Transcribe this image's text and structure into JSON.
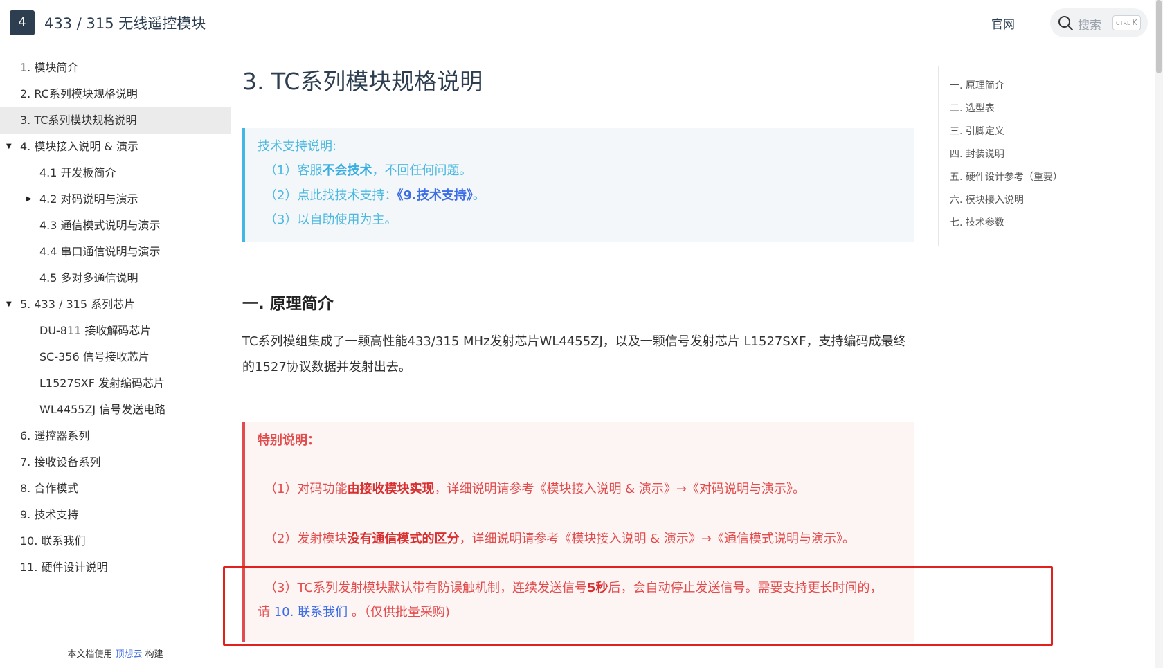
{
  "header": {
    "logo_text": "4",
    "site_title": "433 / 315 无线遥控模块",
    "nav_link": "官网",
    "search_placeholder": "搜索",
    "search_shortcut_mod": "CTRL",
    "search_shortcut_key": "K"
  },
  "sidebar": {
    "items": [
      {
        "label": "1. 模块简介"
      },
      {
        "label": "2. RC系列模块规格说明"
      },
      {
        "label": "3. TC系列模块规格说明"
      },
      {
        "label": "4. 模块接入说明 & 演示"
      },
      {
        "label": "4.1 开发板简介"
      },
      {
        "label": "4.2 对码说明与演示"
      },
      {
        "label": "4.3 通信模式说明与演示"
      },
      {
        "label": "4.4 串口通信说明与演示"
      },
      {
        "label": "4.5 多对多通信说明"
      },
      {
        "label": "5. 433 / 315 系列芯片"
      },
      {
        "label": "DU-811 接收解码芯片"
      },
      {
        "label": "SC-356 信号接收芯片"
      },
      {
        "label": "L1527SXF 发射编码芯片"
      },
      {
        "label": "WL4455ZJ 信号发送电路"
      },
      {
        "label": "6. 遥控器系列"
      },
      {
        "label": "7. 接收设备系列"
      },
      {
        "label": "8. 合作模式"
      },
      {
        "label": "9. 技术支持"
      },
      {
        "label": "10. 联系我们"
      },
      {
        "label": "11. 硬件设计说明"
      }
    ],
    "active_index": 2,
    "footer": {
      "prefix": "本文档使用",
      "link": "顶想云",
      "suffix": "构建"
    }
  },
  "main": {
    "page_title": "3. TC系列模块规格说明",
    "tip": {
      "title": "技术支持说明:",
      "line1_prefix": "（1）客服",
      "line1_bold": "不会技术",
      "line1_suffix": "，不回任何问题。",
      "line2_prefix": "（2）点此找技术支持：",
      "line2_link": "《9.技术支持》",
      "line2_suffix": "。",
      "line3": "（3）以自助使用为主。"
    },
    "section_heading": "一. 原理简介",
    "paragraph": "TC系列模组集成了一颗高性能433/315 MHz发射芯片WL4455ZJ，以及一颗信号发射芯片 L1527SXF，支持编码成最终的1527协议数据并发射出去。",
    "warning": {
      "title": "特别说明：",
      "line1_prefix": "（1）对码功能",
      "line1_bold": "由接收模块实现",
      "line1_suffix": "，详细说明请参考《模块接入说明 & 演示》→《对码说明与演示》。",
      "line2_prefix": "（2）发射模块",
      "line2_bold": "没有通信模式的区分",
      "line2_suffix": "，详细说明请参考《模块接入说明 & 演示》→《通信模式说明与演示》。",
      "line3_prefix": "（3）TC系列发射模块默认带有防误触机制，连续发送信号",
      "line3_bold": "5秒",
      "line3_suffix": "后，会自动停止发送信号。需要支持更长时间的，",
      "line4_prefix": "请 ",
      "line4_link": "10. 联系我们",
      "line4_suffix": " 。（仅供批量采购)"
    }
  },
  "toc": {
    "items": [
      {
        "label": "一. 原理简介"
      },
      {
        "label": "二. 选型表"
      },
      {
        "label": "三. 引脚定义"
      },
      {
        "label": "四. 封装说明"
      },
      {
        "label": "五. 硬件设计参考（重要）"
      },
      {
        "label": "六. 模块接入说明"
      },
      {
        "label": "七. 技术参数"
      }
    ]
  },
  "colors": {
    "tip_accent": "#42b7e7",
    "warn_accent": "#e24c4c",
    "link": "#3d6ee6",
    "highlight_box": "#e0211e"
  }
}
